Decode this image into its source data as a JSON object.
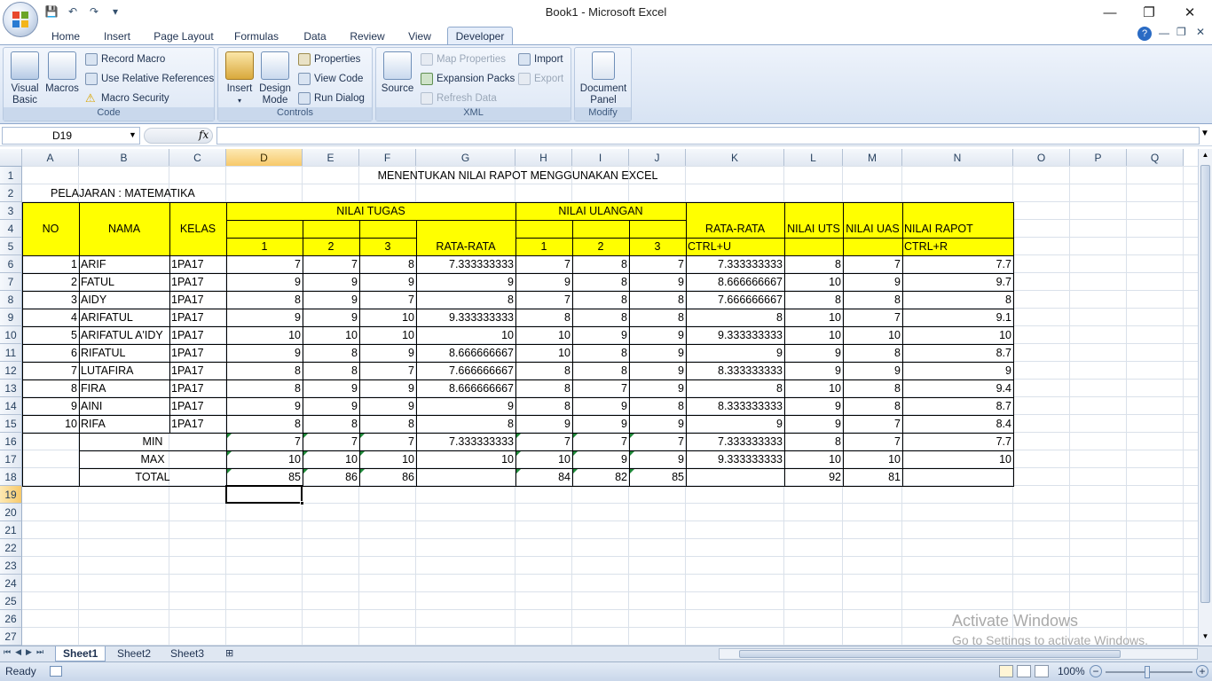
{
  "window": {
    "title": "Book1 - Microsoft Excel",
    "min": "—",
    "restore": "❐",
    "close": "✕"
  },
  "qat": {
    "save": "💾",
    "undo": "↶",
    "redo": "↷",
    "more": "▾"
  },
  "tabs": [
    "Home",
    "Insert",
    "Page Layout",
    "Formulas",
    "Data",
    "Review",
    "View",
    "Developer"
  ],
  "ribbon": {
    "code": {
      "label": "Code",
      "visual_basic": [
        "Visual",
        "Basic"
      ],
      "macros": "Macros",
      "record_macro": "Record Macro",
      "relative": "Use Relative References",
      "security": "Macro Security"
    },
    "controls": {
      "label": "Controls",
      "insert": "Insert",
      "design": [
        "Design",
        "Mode"
      ],
      "properties": "Properties",
      "view_code": "View Code",
      "run_dialog": "Run Dialog"
    },
    "xml": {
      "label": "XML",
      "source": "Source",
      "map_properties": "Map Properties",
      "expansion_packs": "Expansion Packs",
      "refresh_data": "Refresh Data",
      "import": "Import",
      "export": "Export"
    },
    "modify": {
      "label": "Modify",
      "document_panel": [
        "Document",
        "Panel"
      ]
    }
  },
  "formula_bar": {
    "name_box": "D19",
    "fx": "fx",
    "formula": ""
  },
  "columns": [
    "A",
    "B",
    "C",
    "D",
    "E",
    "F",
    "G",
    "H",
    "I",
    "J",
    "K",
    "L",
    "M",
    "N",
    "O",
    "P",
    "Q"
  ],
  "selected_cell": "D19",
  "rows": [
    "1",
    "2",
    "3",
    "4",
    "5",
    "6",
    "7",
    "8",
    "9",
    "10",
    "11",
    "12",
    "13",
    "14",
    "15",
    "16",
    "17",
    "18",
    "19",
    "20",
    "21",
    "22",
    "23",
    "24",
    "25",
    "26",
    "27"
  ],
  "sheet": {
    "title": "MENENTUKAN NILAI RAPOT MENGGUNAKAN EXCEL",
    "subject": "PELAJARAN : MATEMATIKA",
    "headers": {
      "no": "NO",
      "nama": "NAMA",
      "kelas": "KELAS",
      "nilai_tugas": "NILAI TUGAS",
      "nilai_ulangan": "NILAI ULANGAN",
      "t1": "1",
      "t2": "2",
      "t3": "3",
      "t_rata": "RATA-RATA",
      "u1": "1",
      "u2": "2",
      "u3": "3",
      "rata_rata": "RATA-RATA",
      "ctrl_u": "CTRL+U",
      "uts": "NILAI UTS",
      "uas": "NILAI UAS",
      "rapot": "NILAI RAPOT",
      "ctrl_r": "CTRL+R"
    },
    "students": [
      [
        "1",
        "ARIF",
        "1PA17",
        "7",
        "7",
        "8",
        "7.333333333",
        "7",
        "8",
        "7",
        "7.333333333",
        "8",
        "7",
        "7.7"
      ],
      [
        "2",
        "FATUL",
        "1PA17",
        "9",
        "9",
        "9",
        "9",
        "9",
        "8",
        "9",
        "8.666666667",
        "10",
        "9",
        "9.7"
      ],
      [
        "3",
        "AIDY",
        "1PA17",
        "8",
        "9",
        "7",
        "8",
        "7",
        "8",
        "8",
        "7.666666667",
        "8",
        "8",
        "8"
      ],
      [
        "4",
        "ARIFATUL",
        "1PA17",
        "9",
        "9",
        "10",
        "9.333333333",
        "8",
        "8",
        "8",
        "8",
        "10",
        "7",
        "9.1"
      ],
      [
        "5",
        "ARIFATUL A'IDY",
        "1PA17",
        "10",
        "10",
        "10",
        "10",
        "10",
        "9",
        "9",
        "9.333333333",
        "10",
        "10",
        "10"
      ],
      [
        "6",
        "RIFATUL",
        "1PA17",
        "9",
        "8",
        "9",
        "8.666666667",
        "10",
        "8",
        "9",
        "9",
        "9",
        "8",
        "8.7"
      ],
      [
        "7",
        "LUTAFIRA",
        "1PA17",
        "8",
        "8",
        "7",
        "7.666666667",
        "8",
        "8",
        "9",
        "8.333333333",
        "9",
        "9",
        "9"
      ],
      [
        "8",
        "FIRA",
        "1PA17",
        "8",
        "9",
        "9",
        "8.666666667",
        "8",
        "7",
        "9",
        "8",
        "10",
        "8",
        "9.4"
      ],
      [
        "9",
        "AINI",
        "1PA17",
        "9",
        "9",
        "9",
        "9",
        "8",
        "9",
        "8",
        "8.333333333",
        "9",
        "8",
        "8.7"
      ],
      [
        "10",
        "RIFA",
        "1PA17",
        "8",
        "8",
        "8",
        "8",
        "9",
        "9",
        "9",
        "9",
        "9",
        "7",
        "8.4"
      ]
    ],
    "summary": [
      {
        "label": "MIN",
        "values": [
          "7",
          "7",
          "7",
          "7.333333333",
          "7",
          "7",
          "7",
          "7.333333333",
          "8",
          "7",
          "7.7"
        ]
      },
      {
        "label": "MAX",
        "values": [
          "10",
          "10",
          "10",
          "10",
          "10",
          "9",
          "9",
          "9.333333333",
          "10",
          "10",
          "10"
        ]
      },
      {
        "label": "TOTAL",
        "values": [
          "85",
          "86",
          "86",
          "",
          "84",
          "82",
          "85",
          "",
          "92",
          "81",
          ""
        ]
      }
    ]
  },
  "sheet_tabs": [
    "Sheet1",
    "Sheet2",
    "Sheet3"
  ],
  "status": {
    "ready": "Ready",
    "zoom": "100%"
  },
  "watermark": {
    "line1": "Activate Windows",
    "line2": "Go to Settings to activate Windows."
  }
}
